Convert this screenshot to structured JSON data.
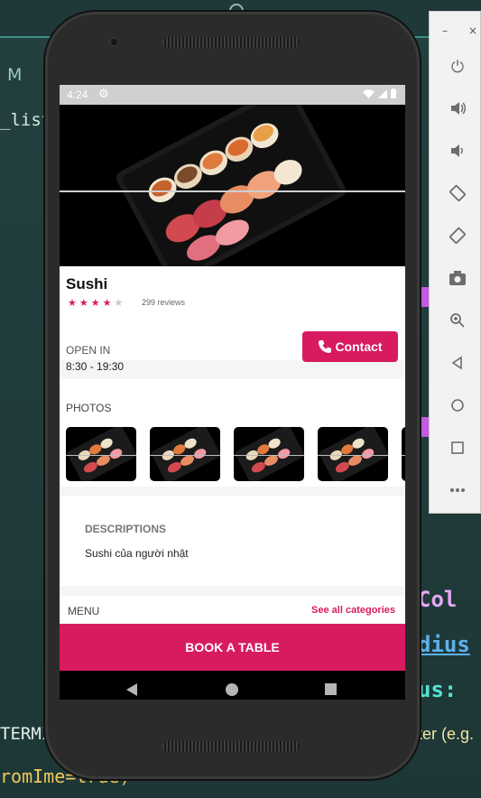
{
  "ide": {
    "tab_label": "M",
    "code_fragment_list": "_listF",
    "terminal_fragment": "TERMI",
    "code_fragment_ime": "romIme=true)",
    "code_fragment_col": "Col",
    "code_fragment_dius": "dius",
    "code_fragment_us": "us:",
    "hint_fragment": "ter (e.g."
  },
  "emulator": {
    "window_controls": [
      "–",
      "×"
    ],
    "buttons": [
      {
        "name": "power-icon",
        "glyph": "⏻"
      },
      {
        "name": "volume-up-icon",
        "glyph": "🔊"
      },
      {
        "name": "volume-down-icon",
        "glyph": "🔉"
      },
      {
        "name": "rotate-left-icon",
        "glyph": "⟲"
      },
      {
        "name": "rotate-right-icon",
        "glyph": "⟳"
      },
      {
        "name": "camera-icon",
        "glyph": "📷"
      },
      {
        "name": "zoom-icon",
        "glyph": "🔍"
      },
      {
        "name": "back-icon",
        "glyph": "◁"
      },
      {
        "name": "home-icon",
        "glyph": "○"
      },
      {
        "name": "overview-icon",
        "glyph": "□"
      },
      {
        "name": "more-icon",
        "glyph": "⋯"
      }
    ]
  },
  "statusbar": {
    "time": "4:24"
  },
  "restaurant": {
    "name": "Sushi",
    "rating": 4,
    "max_rating": 5,
    "reviews": "299 reviews",
    "open_label": "OPEN IN",
    "hours": "8:30 - 19:30",
    "contact_label": "Contact"
  },
  "photos": {
    "label": "PHOTOS",
    "count_visible": 5
  },
  "descriptions": {
    "label": "DESCRIPTIONS",
    "text": "Sushi của người nhật"
  },
  "menu": {
    "label": "MENU",
    "see_all": "See all categories"
  },
  "book": {
    "label": "BOOK A TABLE"
  },
  "colors": {
    "accent": "#d81b60",
    "ide_bg": "#1f3b3a"
  }
}
